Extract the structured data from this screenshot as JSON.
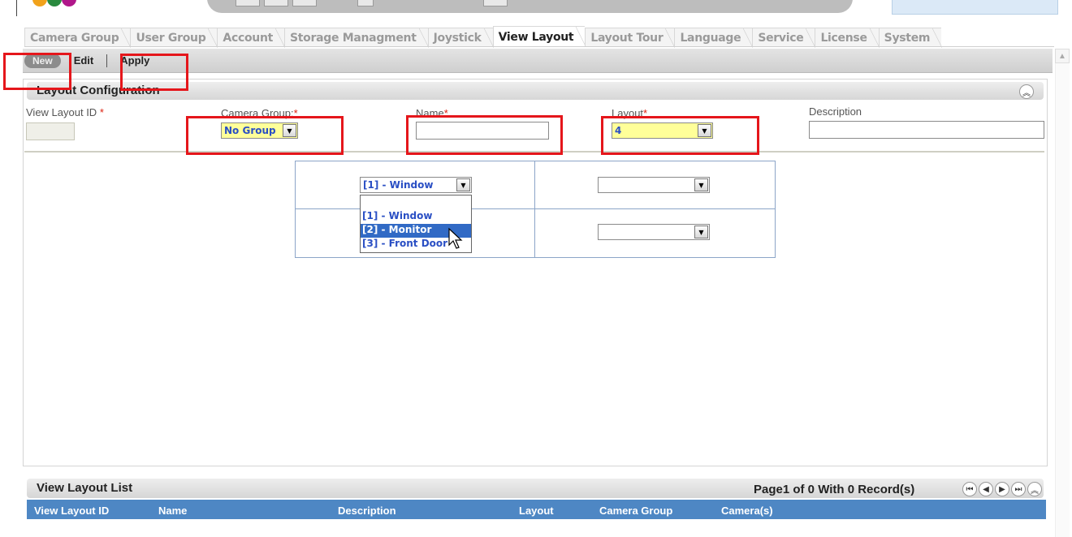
{
  "tabs": [
    {
      "label": "Camera Group",
      "active": false
    },
    {
      "label": "User Group",
      "active": false
    },
    {
      "label": "Account",
      "active": false
    },
    {
      "label": "Storage Managment",
      "active": false
    },
    {
      "label": "Joystick",
      "active": false
    },
    {
      "label": "View Layout",
      "active": true
    },
    {
      "label": "Layout Tour",
      "active": false
    },
    {
      "label": "Language",
      "active": false
    },
    {
      "label": "Service",
      "active": false
    },
    {
      "label": "License",
      "active": false
    },
    {
      "label": "System",
      "active": false
    }
  ],
  "toolbar": {
    "new_label": "New",
    "edit_label": "Edit",
    "apply_label": "Apply"
  },
  "config": {
    "title": "Layout Configuration",
    "collapse_icon": "double-chevron-up-icon",
    "fields": {
      "view_layout_id": {
        "label": "View Layout ID",
        "required_mark": "*",
        "value": ""
      },
      "camera_group": {
        "label": "Camera Group:",
        "required_mark": "*",
        "value": "No Group"
      },
      "name": {
        "label": "Name",
        "required_mark": "*",
        "value": ""
      },
      "layout": {
        "label": "Layout",
        "required_mark": "*",
        "value": "4"
      },
      "description": {
        "label": "Description",
        "value": ""
      }
    },
    "grid": {
      "cells": [
        {
          "value": "[1] - Window"
        },
        {
          "value": ""
        },
        {
          "value": ""
        },
        {
          "value": ""
        }
      ],
      "open_dropdown_options": [
        "[1] - Window",
        "[2] - Monitor",
        "[3] - Front Door"
      ],
      "highlighted_option": "[2] - Monitor"
    }
  },
  "list": {
    "title": "View Layout List",
    "pager_text": "Page1 of 0 With 0 Record(s)",
    "columns": [
      "View Layout ID",
      "Name",
      "Description",
      "Layout",
      "Camera Group",
      "Camera(s)"
    ]
  },
  "colors": {
    "annotation_red": "#e5161b",
    "header_blue": "#4e87c4",
    "highlight_blue": "#316ac5",
    "required_yellow": "#ffff99"
  }
}
